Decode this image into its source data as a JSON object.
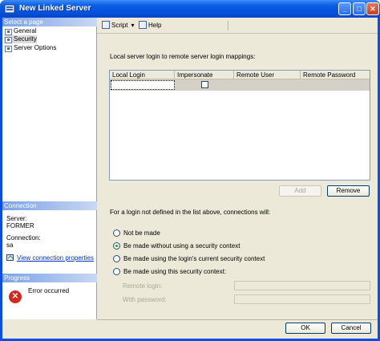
{
  "window": {
    "title": "New Linked Server"
  },
  "title_buttons": {
    "minimize": "_",
    "maximize": "□",
    "close": "✕"
  },
  "left": {
    "select_page_header": "Select a page",
    "pages": [
      "General",
      "Security",
      "Server Options"
    ],
    "connection_header": "Connection",
    "server_label": "Server:",
    "server_value": "FORMER",
    "connection_label": "Connection:",
    "connection_value": "sa",
    "view_connection_link": "View connection properties",
    "progress_header": "Progress",
    "progress_status": "Error occurred"
  },
  "toolbar": {
    "script_label": "Script",
    "help_label": "Help"
  },
  "main": {
    "mappings_label": "Local server login to remote server login mappings:",
    "columns": [
      "Local Login",
      "Impersonate",
      "Remote User",
      "Remote Password"
    ],
    "add_label": "Add",
    "remove_label": "Remove",
    "undefined_label": "For a login not defined in the list above, connections will:",
    "options": [
      "Not be made",
      "Be made without using a security context",
      "Be made using the login's current security context",
      "Be made using this security context:"
    ],
    "selected_option": 1,
    "remote_login_label": "Remote login:",
    "with_password_label": "With password:"
  },
  "footer": {
    "ok_label": "OK",
    "cancel_label": "Cancel"
  }
}
